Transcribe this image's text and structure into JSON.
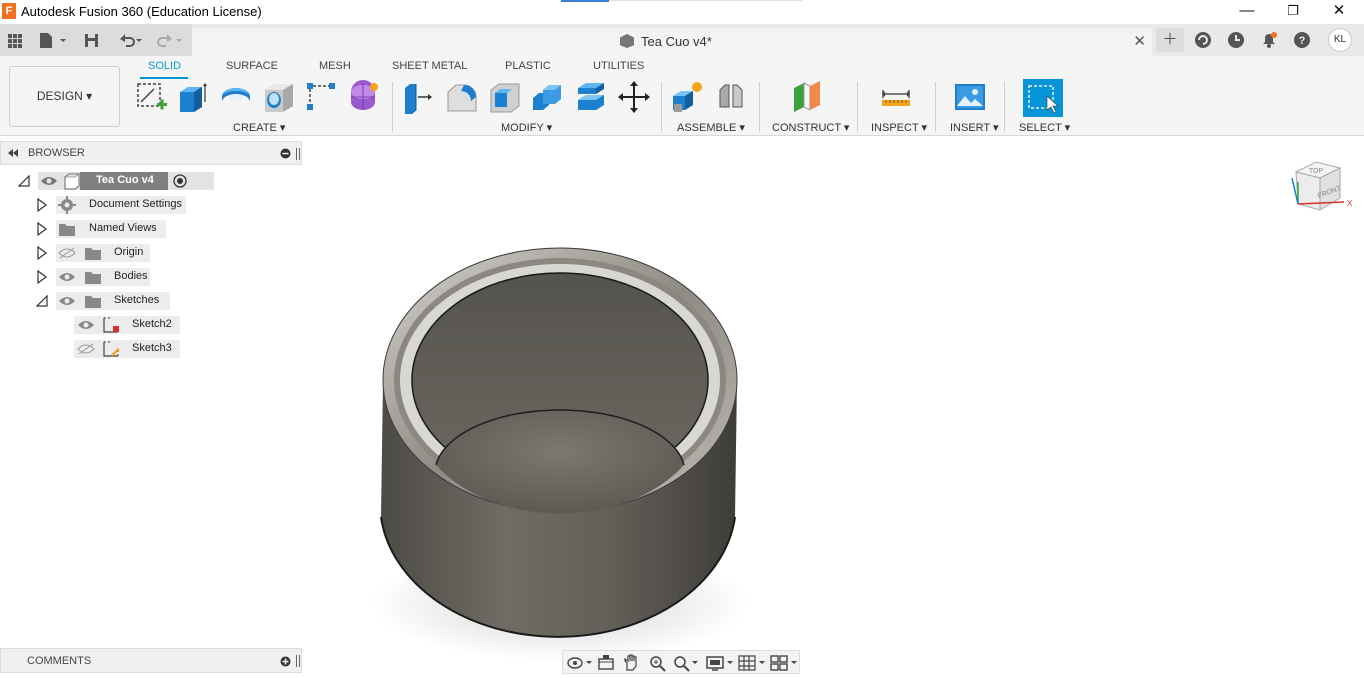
{
  "window": {
    "title": "Autodesk Fusion 360 (Education License)",
    "minimize": "—",
    "maximize": "❐",
    "close": "✕"
  },
  "document": {
    "name": "Tea Cuo v4*",
    "user_initials": "KL"
  },
  "workspace": {
    "label": "DESIGN ▾"
  },
  "tabs": [
    "SOLID",
    "SURFACE",
    "MESH",
    "SHEET METAL",
    "PLASTIC",
    "UTILITIES"
  ],
  "groups": {
    "create": "CREATE ▾",
    "modify": "MODIFY ▾",
    "assemble": "ASSEMBLE ▾",
    "construct": "CONSTRUCT ▾",
    "inspect": "INSPECT ▾",
    "insert": "INSERT ▾",
    "select": "SELECT ▾"
  },
  "browser": {
    "title": "BROWSER",
    "root": "Tea Cuo v4",
    "items": [
      {
        "label": "Document Settings",
        "icon": "gear-icon"
      },
      {
        "label": "Named Views",
        "icon": "folder-icon"
      },
      {
        "label": "Origin",
        "icon": "folder-icon"
      },
      {
        "label": "Bodies",
        "icon": "folder-icon"
      },
      {
        "label": "Sketches",
        "icon": "folder-icon"
      }
    ],
    "sketches": [
      {
        "label": "Sketch2",
        "visible": true
      },
      {
        "label": "Sketch3",
        "visible": false
      }
    ]
  },
  "comments": {
    "title": "COMMENTS"
  },
  "viewcube": {
    "top": "TOP",
    "front": "FRONT"
  },
  "colors": {
    "accent": "#0696d7",
    "body": "#6e6b63",
    "select": "#0696d7"
  }
}
